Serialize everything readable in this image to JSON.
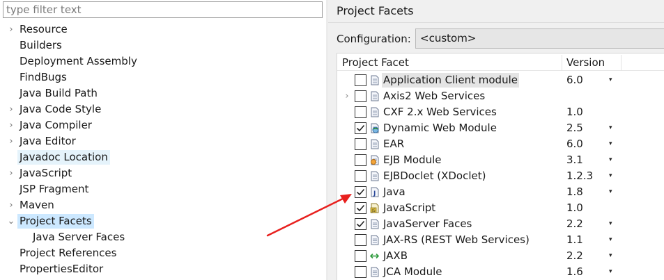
{
  "filter": {
    "placeholder": "type filter text"
  },
  "tree": {
    "items": [
      {
        "label": "Resource",
        "has_arrow": true,
        "arrow": "›",
        "state": ""
      },
      {
        "label": "Builders",
        "has_arrow": false,
        "state": ""
      },
      {
        "label": "Deployment Assembly",
        "has_arrow": false,
        "state": ""
      },
      {
        "label": "FindBugs",
        "has_arrow": false,
        "state": ""
      },
      {
        "label": "Java Build Path",
        "has_arrow": false,
        "state": ""
      },
      {
        "label": "Java Code Style",
        "has_arrow": true,
        "arrow": "›",
        "state": ""
      },
      {
        "label": "Java Compiler",
        "has_arrow": true,
        "arrow": "›",
        "state": ""
      },
      {
        "label": "Java Editor",
        "has_arrow": true,
        "arrow": "›",
        "state": ""
      },
      {
        "label": "Javadoc Location",
        "has_arrow": false,
        "state": "hover"
      },
      {
        "label": "JavaScript",
        "has_arrow": true,
        "arrow": "›",
        "state": ""
      },
      {
        "label": "JSP Fragment",
        "has_arrow": false,
        "state": ""
      },
      {
        "label": "Maven",
        "has_arrow": true,
        "arrow": "›",
        "state": ""
      },
      {
        "label": "Project Facets",
        "has_arrow": true,
        "arrow": "⌄",
        "state": "selected"
      },
      {
        "label": "Java Server Faces",
        "has_arrow": false,
        "state": "",
        "indent": 1
      },
      {
        "label": "Project References",
        "has_arrow": false,
        "state": ""
      },
      {
        "label": "PropertiesEditor",
        "has_arrow": false,
        "state": ""
      }
    ]
  },
  "page": {
    "title": "Project Facets"
  },
  "configuration": {
    "label": "Configuration:",
    "value": "<custom>"
  },
  "table": {
    "headers": {
      "facet": "Project Facet",
      "version": "Version"
    },
    "rows": [
      {
        "name": "Application Client module",
        "version": "6.0",
        "checked": false,
        "dropdown": true,
        "icon": "document-icon",
        "selected": true,
        "expandable": false
      },
      {
        "name": "Axis2 Web Services",
        "version": "",
        "checked": false,
        "dropdown": false,
        "icon": "document-icon",
        "selected": false,
        "expandable": true
      },
      {
        "name": "CXF 2.x Web Services",
        "version": "1.0",
        "checked": false,
        "dropdown": false,
        "icon": "document-icon",
        "selected": false,
        "expandable": false
      },
      {
        "name": "Dynamic Web Module",
        "version": "2.5",
        "checked": true,
        "dropdown": true,
        "icon": "web-module-icon",
        "selected": false,
        "expandable": false
      },
      {
        "name": "EAR",
        "version": "6.0",
        "checked": false,
        "dropdown": true,
        "icon": "document-icon",
        "selected": false,
        "expandable": false
      },
      {
        "name": "EJB Module",
        "version": "3.1",
        "checked": false,
        "dropdown": true,
        "icon": "ejb-module-icon",
        "selected": false,
        "expandable": false
      },
      {
        "name": "EJBDoclet (XDoclet)",
        "version": "1.2.3",
        "checked": false,
        "dropdown": true,
        "icon": "document-icon",
        "selected": false,
        "expandable": false
      },
      {
        "name": "Java",
        "version": "1.8",
        "checked": true,
        "dropdown": true,
        "icon": "java-icon",
        "selected": false,
        "expandable": false
      },
      {
        "name": "JavaScript",
        "version": "1.0",
        "checked": true,
        "dropdown": false,
        "icon": "javascript-icon",
        "selected": false,
        "expandable": false
      },
      {
        "name": "JavaServer Faces",
        "version": "2.2",
        "checked": true,
        "dropdown": true,
        "icon": "document-icon",
        "selected": false,
        "expandable": false
      },
      {
        "name": "JAX-RS (REST Web Services)",
        "version": "1.1",
        "checked": false,
        "dropdown": true,
        "icon": "document-icon",
        "selected": false,
        "expandable": false
      },
      {
        "name": "JAXB",
        "version": "2.2",
        "checked": false,
        "dropdown": true,
        "icon": "jaxb-icon",
        "selected": false,
        "expandable": false
      },
      {
        "name": "JCA Module",
        "version": "1.6",
        "checked": false,
        "dropdown": true,
        "icon": "document-icon",
        "selected": false,
        "expandable": false
      }
    ]
  },
  "colors": {
    "selected": "#cce8ff",
    "hover": "#e5f3fb",
    "annotation": "#e8201e"
  },
  "glyphs": {
    "dropdown": "▾"
  }
}
